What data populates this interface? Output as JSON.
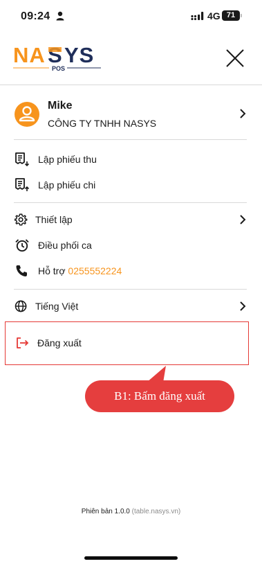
{
  "status_bar": {
    "time": "09:24",
    "network": "4G",
    "battery": "71"
  },
  "header": {
    "logo_text": "NASYS",
    "logo_sub": "POS",
    "close_icon": "close-icon"
  },
  "profile": {
    "name": "Mike",
    "company": "CÔNG TY TNHH NASYS",
    "icon": "user-icon"
  },
  "menu": {
    "receipt": {
      "label": "Lập phiếu thu",
      "icon": "receipt-in-icon"
    },
    "payment": {
      "label": "Lập phiếu chi",
      "icon": "receipt-out-icon"
    },
    "settings": {
      "label": "Thiết lập",
      "icon": "gear-icon"
    },
    "shift": {
      "label": "Điều phối ca",
      "icon": "alarm-clock-icon"
    },
    "support": {
      "label": "Hỗ trợ",
      "phone": "0255552224",
      "icon": "phone-icon"
    },
    "language": {
      "label": "Tiếng Việt",
      "icon": "globe-icon"
    },
    "logout": {
      "label": "Đăng xuất",
      "icon": "logout-icon"
    }
  },
  "annotation": {
    "callout_text": "B1: Bấm đăng xuất"
  },
  "footer": {
    "version": "Phiên bản 1.0.0",
    "url": "(table.nasys.vn)"
  },
  "colors": {
    "brand_orange": "#f7941d",
    "brand_navy": "#1f2e5a",
    "highlight_red": "#e53935",
    "callout_red": "#e53e3e"
  }
}
